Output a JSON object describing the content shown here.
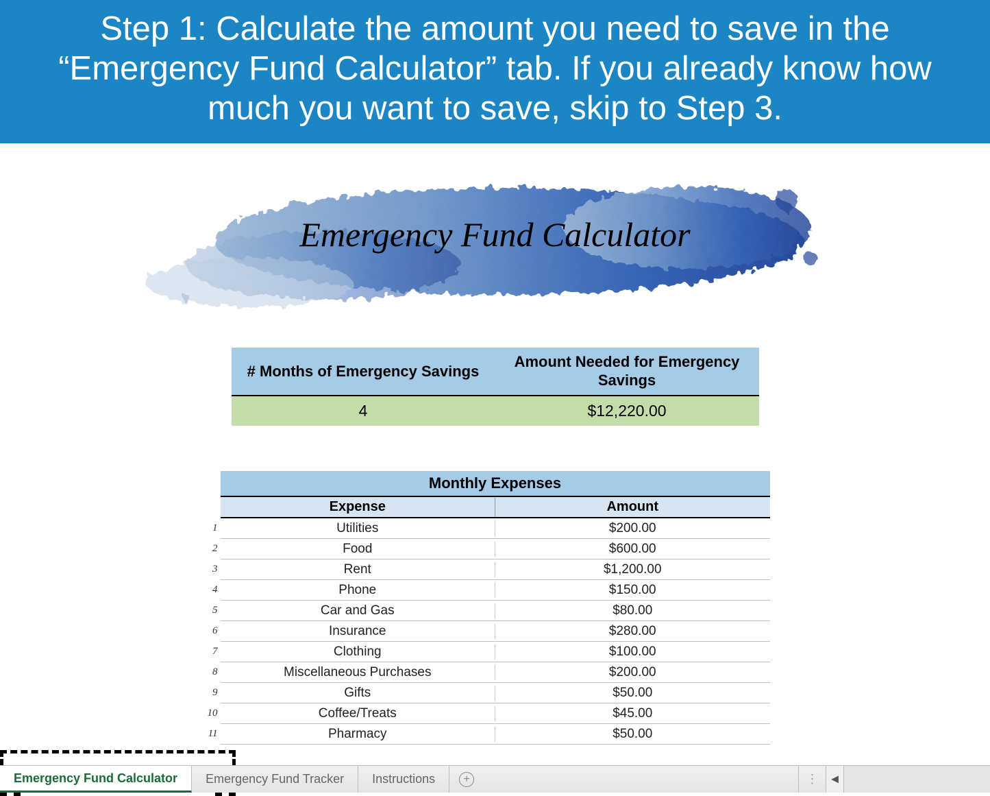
{
  "header": {
    "instruction_text": "Step 1: Calculate the amount you need to save in the “Emergency Fund Calculator” tab. If you already know how much you want to save, skip to Step 3."
  },
  "brush": {
    "title": "Emergency Fund Calculator"
  },
  "summary": {
    "col1_header": "# Months of Emergency Savings",
    "col2_header": "Amount Needed for Emergency Savings",
    "months_value": "4",
    "amount_value": "$12,220.00"
  },
  "expenses": {
    "title": "Monthly Expenses",
    "col_expense": "Expense",
    "col_amount": "Amount",
    "rows": [
      {
        "n": "1",
        "expense": "Utilities",
        "amount": "$200.00"
      },
      {
        "n": "2",
        "expense": "Food",
        "amount": "$600.00"
      },
      {
        "n": "3",
        "expense": "Rent",
        "amount": "$1,200.00"
      },
      {
        "n": "4",
        "expense": "Phone",
        "amount": "$150.00"
      },
      {
        "n": "5",
        "expense": "Car and Gas",
        "amount": "$80.00"
      },
      {
        "n": "6",
        "expense": "Insurance",
        "amount": "$280.00"
      },
      {
        "n": "7",
        "expense": "Clothing",
        "amount": "$100.00"
      },
      {
        "n": "8",
        "expense": "Miscellaneous Purchases",
        "amount": "$200.00"
      },
      {
        "n": "9",
        "expense": "Gifts",
        "amount": "$50.00"
      },
      {
        "n": "10",
        "expense": "Coffee/Treats",
        "amount": "$45.00"
      },
      {
        "n": "11",
        "expense": "Pharmacy",
        "amount": "$50.00"
      }
    ]
  },
  "tabs": {
    "items": [
      {
        "label": "Emergency Fund Calculator",
        "active": true
      },
      {
        "label": "Emergency Fund Tracker",
        "active": false
      },
      {
        "label": "Instructions",
        "active": false
      }
    ]
  }
}
